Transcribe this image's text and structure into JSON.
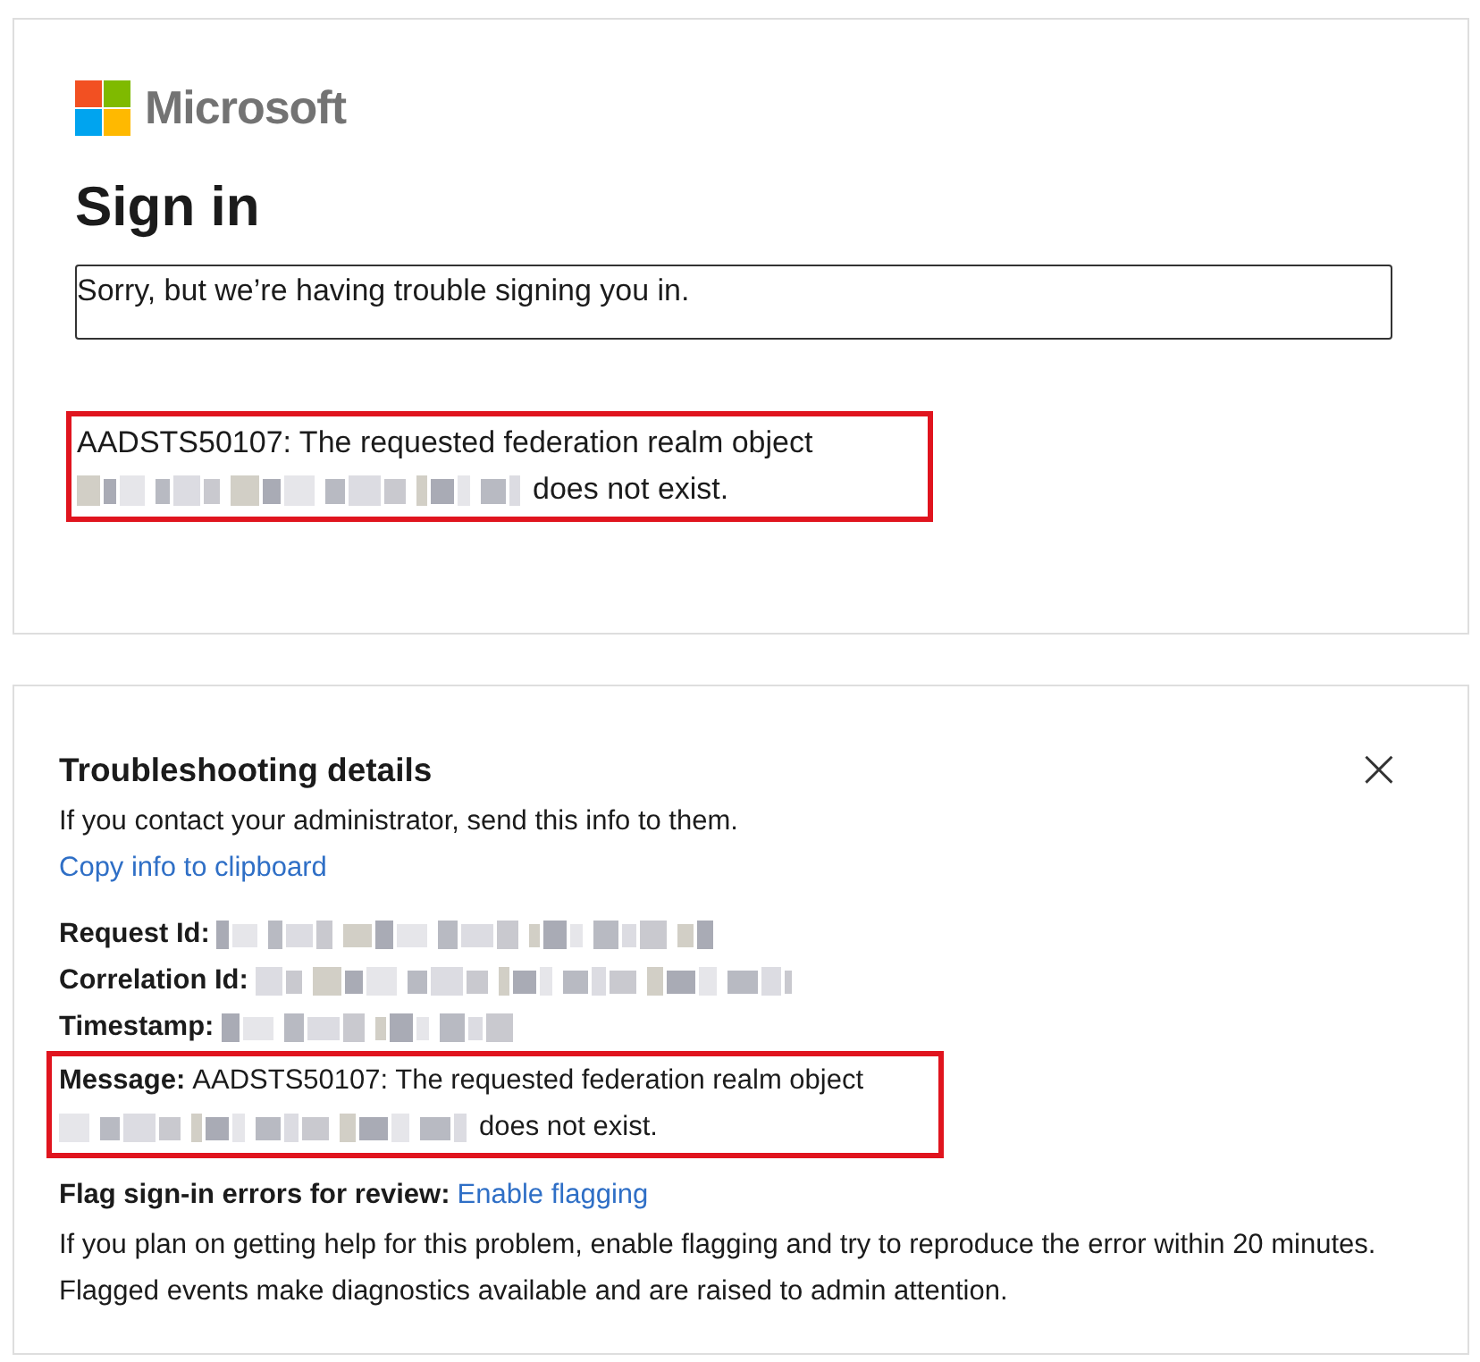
{
  "signin_card": {
    "logo_text": "Microsoft",
    "title": "Sign in",
    "notice": "Sorry, but we’re having trouble signing you in.",
    "error": {
      "line_1": "AADSTS50107: The requested federation realm object",
      "line_2": "does not exist."
    }
  },
  "troubleshooting": {
    "title": "Troubleshooting details",
    "close_icon": "×",
    "intro": "If you contact your administrator, send this info to them.",
    "copy_link": "Copy info to clipboard",
    "fields": [
      {
        "label": "Request Id:"
      },
      {
        "label": "Correlation Id:"
      },
      {
        "label": "Timestamp:"
      }
    ],
    "message": {
      "label": "Message:",
      "line_1": "AADSTS50107: The requested federation realm object",
      "line_2": "does not exist."
    },
    "flag": {
      "label": "Flag sign-in errors for review:",
      "link": "Enable flagging",
      "help": "If you plan on getting help for this problem, enable flagging and try to reproduce the error within 20 minutes. Flagged events make diagnostics available and are raised to admin attention."
    }
  }
}
